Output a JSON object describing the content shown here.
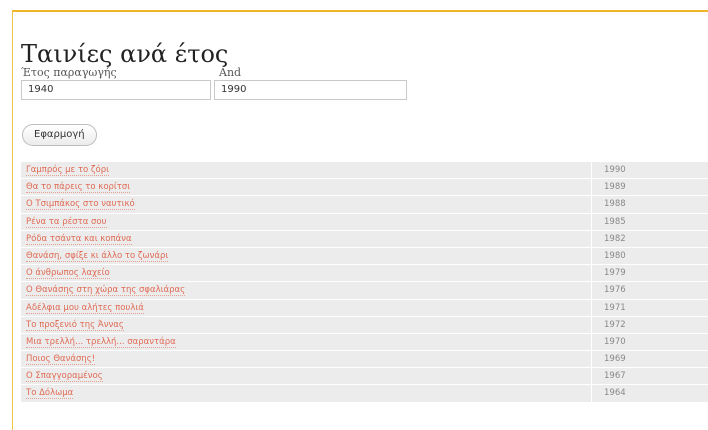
{
  "page": {
    "title": "Ταινίες ανά έτος"
  },
  "filters": {
    "from_label": "Έτος παραγωγής",
    "to_label": "And",
    "from_value": "1940",
    "to_value": "1990",
    "apply_label": "Εφαρμογή"
  },
  "movies": [
    {
      "title": "Γαμπρός με το ζόρι",
      "year": "1990"
    },
    {
      "title": "Θα το πάρεις το κορίτσι",
      "year": "1989"
    },
    {
      "title": "Ο Τσιμπάκος στο ναυτικό",
      "year": "1988"
    },
    {
      "title": "Ρένα τα ρέστα σου",
      "year": "1985"
    },
    {
      "title": "Ρόδα τσάντα και κοπάνα",
      "year": "1982"
    },
    {
      "title": "Θανάση, σφίξε κι άλλο το ζωνάρι",
      "year": "1980"
    },
    {
      "title": "Ο άνθρωπος λαχείο",
      "year": "1979"
    },
    {
      "title": "Ο Θανάσης στη χώρα της σφαλιάρας",
      "year": "1976"
    },
    {
      "title": "Αδέλφια μου αλήτες πουλιά",
      "year": "1971"
    },
    {
      "title": "Το προξενιό της Άννας",
      "year": "1972"
    },
    {
      "title": "Μια τρελλή... τρελλή... σαραντάρα",
      "year": "1970"
    },
    {
      "title": "Ποιος Θανάσης!",
      "year": "1969"
    },
    {
      "title": "Ο Σπαγγοραμένος",
      "year": "1967"
    },
    {
      "title": "Το Δόλωμα",
      "year": "1964"
    }
  ]
}
